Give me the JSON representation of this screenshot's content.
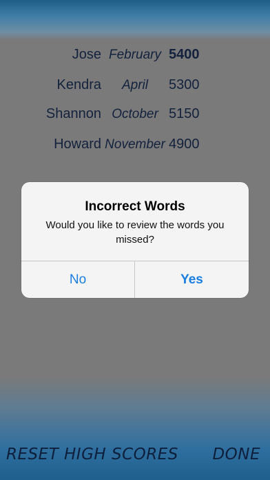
{
  "high_scores": [
    {
      "name": "Jose",
      "month": "February",
      "score": "5400"
    },
    {
      "name": "Kendra",
      "month": "April",
      "score": "5300"
    },
    {
      "name": "Shannon",
      "month": "October",
      "score": "5150"
    },
    {
      "name": "Howard",
      "month": "November",
      "score": "4900"
    }
  ],
  "dialog": {
    "title": "Incorrect Words",
    "message": "Would you like to review the words you missed?",
    "no_label": "No",
    "yes_label": "Yes"
  },
  "footer": {
    "reset_label": "RESET HIGH SCORES",
    "done_label": "DONE"
  },
  "colors": {
    "accent": "#1a7ee0",
    "header_blue": "#1f5e86",
    "text_dark": "#14213c"
  }
}
